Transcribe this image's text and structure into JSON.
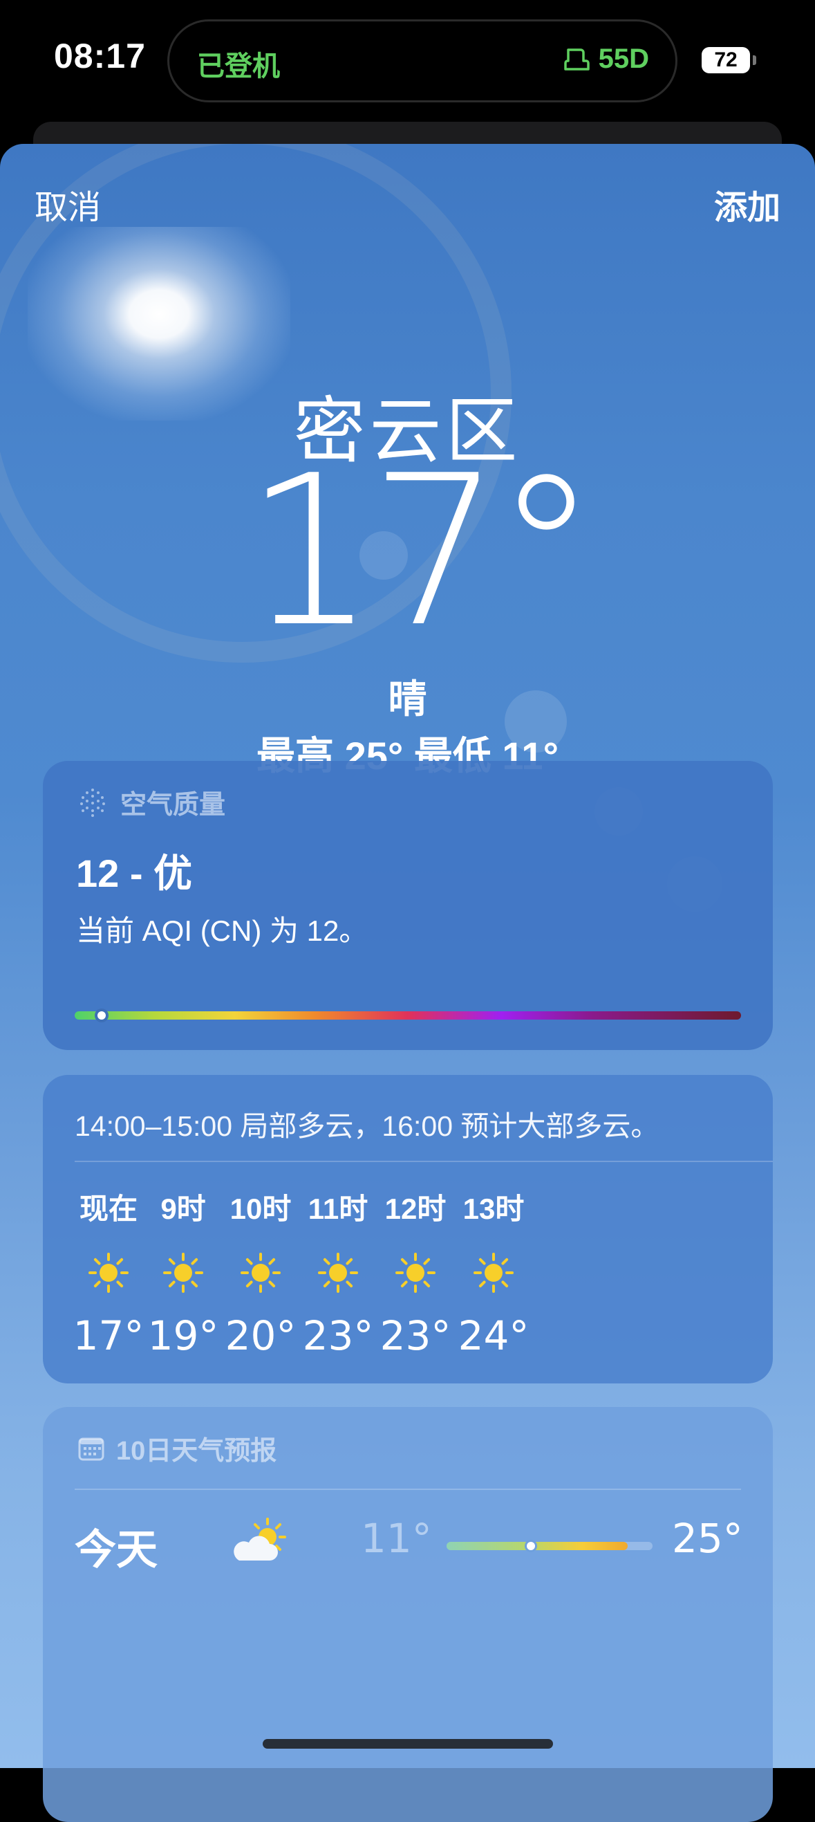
{
  "status_bar": {
    "time": "08:17",
    "flight_status": "已登机",
    "seat": "55D",
    "battery": "72"
  },
  "nav": {
    "cancel_label": "取消",
    "add_label": "添加"
  },
  "current": {
    "city": "密云区",
    "temperature": "17°",
    "condition": "晴",
    "high_low": "最高 25°  最低 11°"
  },
  "air_quality": {
    "title": "空气质量",
    "value": "12 - 优",
    "description": "当前 AQI (CN) 为 12。",
    "level_fraction": 0.03
  },
  "hourly": {
    "summary": "14:00–15:00 局部多云，16:00 预计大部多云。",
    "items": [
      {
        "label": "现在",
        "icon": "sun-icon",
        "temp": "17°"
      },
      {
        "label": "9时",
        "icon": "sun-icon",
        "temp": "19°"
      },
      {
        "label": "10时",
        "icon": "sun-icon",
        "temp": "20°"
      },
      {
        "label": "11时",
        "icon": "sun-icon",
        "temp": "23°"
      },
      {
        "label": "12时",
        "icon": "sun-icon",
        "temp": "23°"
      },
      {
        "label": "13时",
        "icon": "sun-icon",
        "temp": "24°"
      }
    ]
  },
  "ten_day": {
    "title": "10日天气预报",
    "days": [
      {
        "name": "今天",
        "icon": "partly-cloudy-icon",
        "low": "11°",
        "high": "25°",
        "range_start": 0,
        "range_end": 0.88,
        "current_fraction": 0.4
      }
    ]
  },
  "colors": {
    "accent_green": "#5fcf5f",
    "sun_yellow": "#f7cf2a"
  }
}
